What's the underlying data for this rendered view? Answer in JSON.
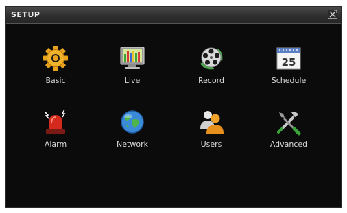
{
  "window": {
    "title": "SETUP",
    "close_icon": "close-window-icon"
  },
  "menu": {
    "items": [
      {
        "label": "Basic",
        "icon": "gear-icon"
      },
      {
        "label": "Live",
        "icon": "monitor-icon"
      },
      {
        "label": "Record",
        "icon": "film-reel-icon"
      },
      {
        "label": "Schedule",
        "icon": "calendar-icon",
        "calendar_day": "25"
      },
      {
        "label": "Alarm",
        "icon": "alarm-siren-icon"
      },
      {
        "label": "Network",
        "icon": "globe-icon"
      },
      {
        "label": "Users",
        "icon": "users-icon"
      },
      {
        "label": "Advanced",
        "icon": "tools-icon"
      }
    ]
  },
  "colors": {
    "background": "#0b0b0b",
    "titlebar": "#3a3a3a",
    "label_text": "#d8d8d8"
  }
}
